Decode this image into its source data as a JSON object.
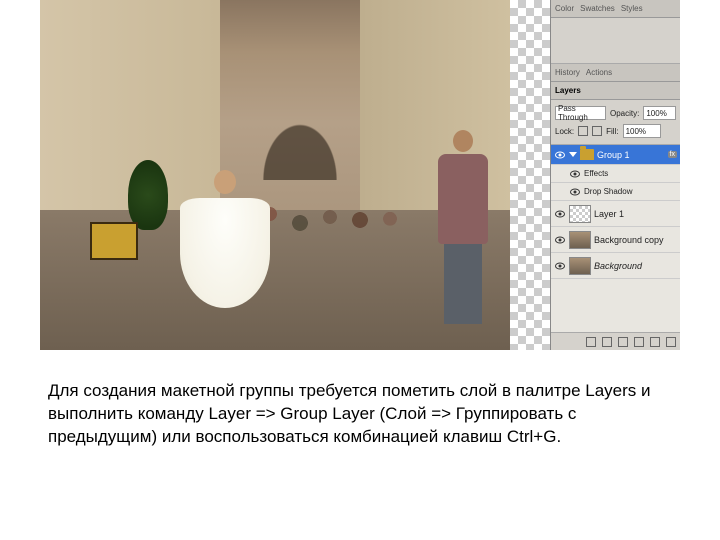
{
  "panels": {
    "colorTabs": [
      "Color",
      "Swatches",
      "Styles"
    ],
    "historyTabs": [
      "History",
      "Actions"
    ],
    "layersTabLabel": "Layers",
    "blendMode": "Pass Through",
    "opacityLabel": "Opacity:",
    "opacityValue": "100%",
    "lockLabel": "Lock:",
    "fillLabel": "Fill:",
    "fillValue": "100%",
    "group": {
      "name": "Group 1",
      "effectsLabel": "Effects",
      "effectItem": "Drop Shadow"
    },
    "layer1": "Layer 1",
    "backgroundCopy": "Background copy",
    "background": "Background",
    "fxBadge": "fx"
  },
  "caption": {
    "text": "Для создания макетной группы требуется пометить слой в палитре Layers и выполнить команду Layer => Group Layer (Слой => Группировать с предыдущим) или воспользоваться комбинацией клавиш Ctrl+G."
  }
}
